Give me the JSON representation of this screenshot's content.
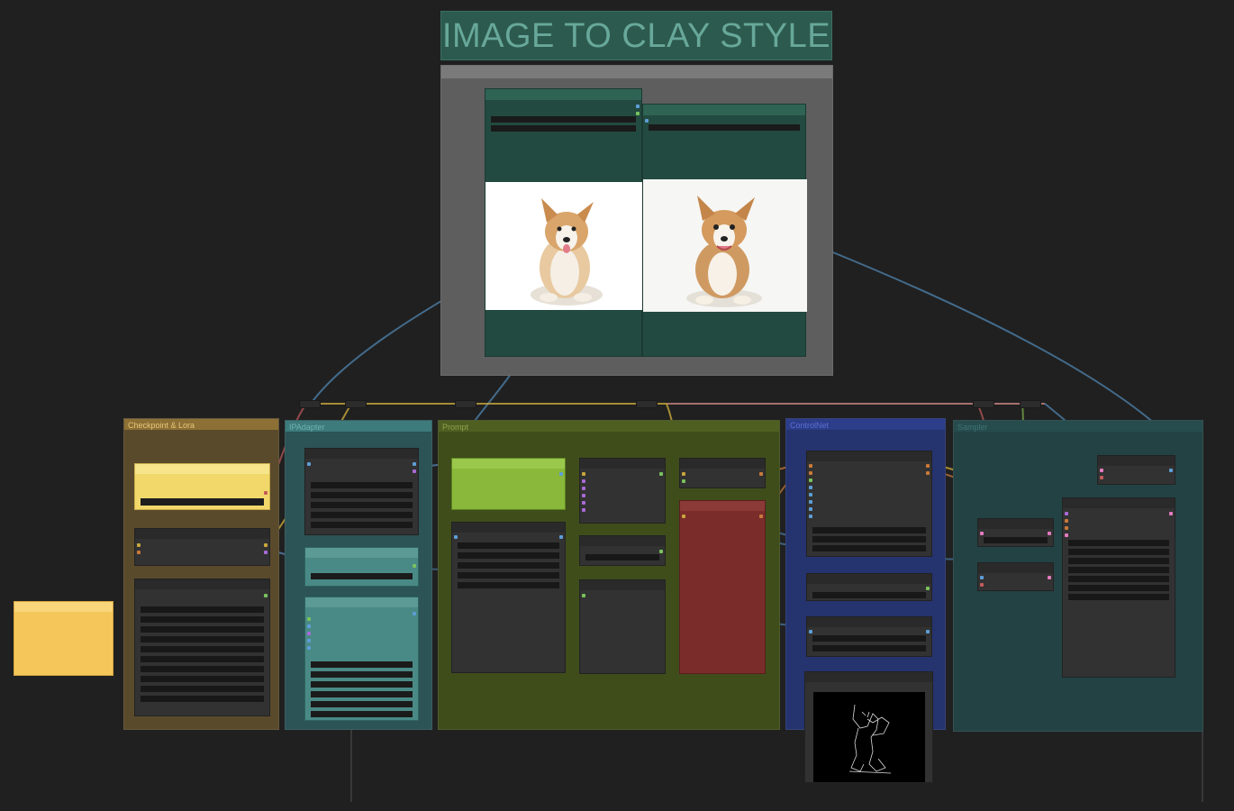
{
  "canvas": {
    "title": "IMAGE TO CLAY STYLE"
  },
  "groups": {
    "checkpoint": {
      "label": "Checkpoint & Lora",
      "color": "#8c7035"
    },
    "ipadapter": {
      "label": "IPAdapter",
      "color": "#3d7b7c"
    },
    "prompt": {
      "label": "Prompt",
      "color": "#4f5f22"
    },
    "controlnet": {
      "label": "ControlNet",
      "color": "#2c3d8a"
    },
    "sampler": {
      "label": "Sampler",
      "color": "#274c4d"
    }
  },
  "images": {
    "input_image": "corgi-photo",
    "output_image": "corgi-clay-render",
    "preprocessor_image": "lineart-preview"
  },
  "colors": {
    "canvas_bg": "#202020",
    "note_yellow": "#f5c75a",
    "load_image_node": "#89b83a",
    "negative_prompt_node": "#7a2c2b",
    "preview_node": "#234a40"
  }
}
